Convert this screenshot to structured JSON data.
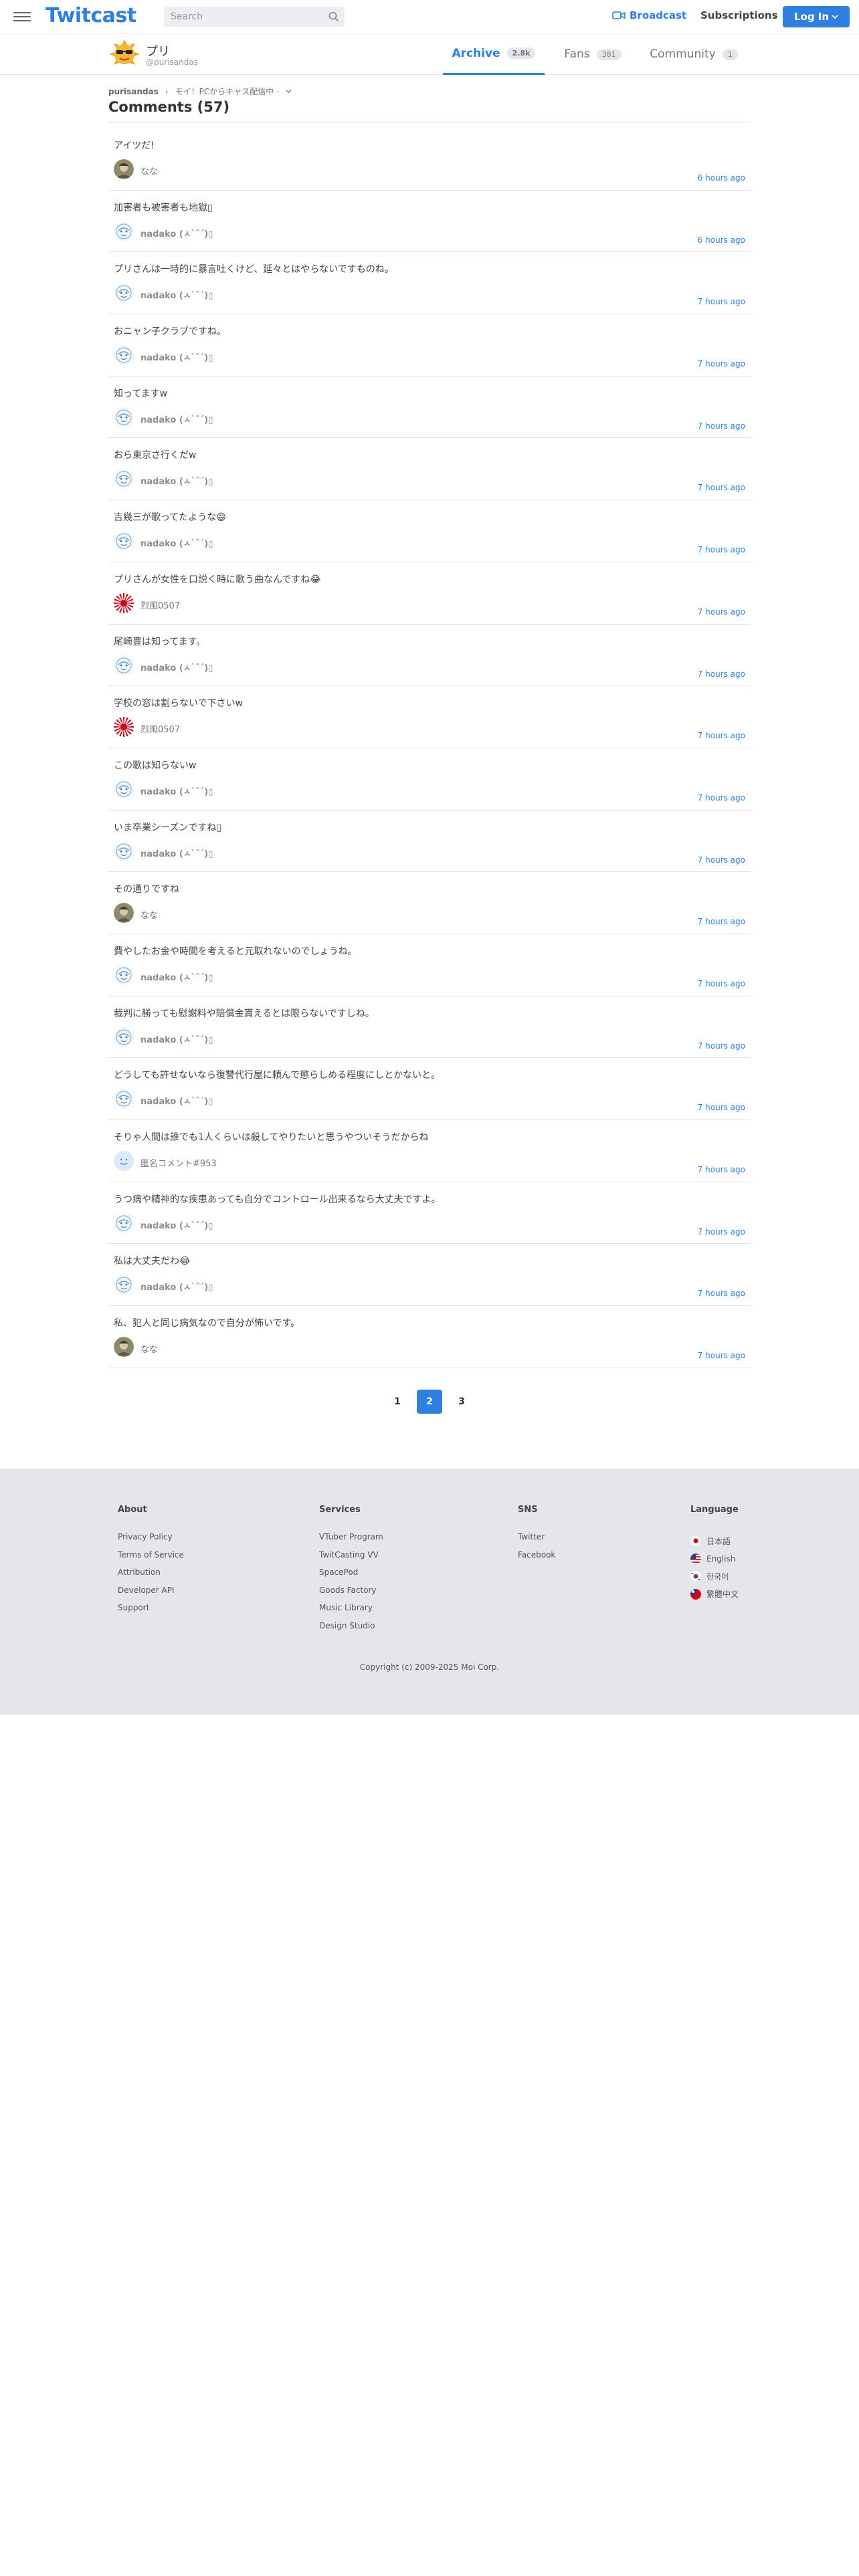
{
  "header": {
    "logo": "Twitcast",
    "search_placeholder": "Search",
    "broadcast_label": "Broadcast",
    "subscriptions_label": "Subscriptions",
    "login_label": "Log In",
    "accent_color": "#2f7fe0"
  },
  "profile": {
    "name": "プリ",
    "handle": "@purisandas",
    "tabs": [
      {
        "label": "Archive",
        "count": "2.8k",
        "active": true
      },
      {
        "label": "Fans",
        "count": "381",
        "active": false
      },
      {
        "label": "Community",
        "count": "1",
        "active": false
      }
    ]
  },
  "breadcrumb": {
    "user": "purisandas",
    "separator": "›",
    "movie": "モイ！PCからキャス配信中 -"
  },
  "page_title": "Comments (57)",
  "comments": [
    {
      "text": "アイツだ!",
      "author": "なな",
      "author_style": "normal",
      "avatar": "photo-olive",
      "time": "6 hours ago"
    },
    {
      "text": "加害者も被害者も地獄▯",
      "author": "nadako (ㅅ`ˆ´)▯",
      "author_style": "bold",
      "avatar": "sketch",
      "time": "6 hours ago"
    },
    {
      "text": "プリさんは一時的に暴言吐くけど、延々とはやらないですものね。",
      "author": "nadako (ㅅ`ˆ´)▯",
      "author_style": "bold",
      "avatar": "sketch",
      "time": "7 hours ago"
    },
    {
      "text": "おニャン子クラブですね。",
      "author": "nadako (ㅅ`ˆ´)▯",
      "author_style": "bold",
      "avatar": "sketch",
      "time": "7 hours ago"
    },
    {
      "text": "知ってますw",
      "author": "nadako (ㅅ`ˆ´)▯",
      "author_style": "bold",
      "avatar": "sketch",
      "time": "7 hours ago"
    },
    {
      "text": "おら東京さ行くだw",
      "author": "nadako (ㅅ`ˆ´)▯",
      "author_style": "bold",
      "avatar": "sketch",
      "time": "7 hours ago"
    },
    {
      "text": "吉幾三が歌ってたような😄",
      "author": "nadako (ㅅ`ˆ´)▯",
      "author_style": "bold",
      "avatar": "sketch",
      "time": "7 hours ago"
    },
    {
      "text": "プリさんが女性を口説く時に歌う曲なんですね😂",
      "author": "烈風0507",
      "author_style": "normal",
      "avatar": "rising-sun",
      "time": "7 hours ago"
    },
    {
      "text": "尾崎豊は知ってます。",
      "author": "nadako (ㅅ`ˆ´)▯",
      "author_style": "bold",
      "avatar": "sketch",
      "time": "7 hours ago"
    },
    {
      "text": "学校の窓は割らないで下さいw",
      "author": "烈風0507",
      "author_style": "normal",
      "avatar": "rising-sun",
      "time": "7 hours ago"
    },
    {
      "text": "この歌は知らないw",
      "author": "nadako (ㅅ`ˆ´)▯",
      "author_style": "bold",
      "avatar": "sketch",
      "time": "7 hours ago"
    },
    {
      "text": "いま卒業シーズンですね▯",
      "author": "nadako (ㅅ`ˆ´)▯",
      "author_style": "bold",
      "avatar": "sketch",
      "time": "7 hours ago"
    },
    {
      "text": "その通りですね",
      "author": "なな",
      "author_style": "normal",
      "avatar": "photo-olive",
      "time": "7 hours ago"
    },
    {
      "text": "費やしたお金や時間を考えると元取れないのでしょうね。",
      "author": "nadako (ㅅ`ˆ´)▯",
      "author_style": "bold",
      "avatar": "sketch",
      "time": "7 hours ago"
    },
    {
      "text": "裁判に勝っても慰謝料や賠償金貰えるとは限らないですしね。",
      "author": "nadako (ㅅ`ˆ´)▯",
      "author_style": "bold",
      "avatar": "sketch",
      "time": "7 hours ago"
    },
    {
      "text": "どうしても許せないなら復讐代行屋に頼んで懲らしめる程度にしとかないと。",
      "author": "nadako (ㅅ`ˆ´)▯",
      "author_style": "bold",
      "avatar": "sketch",
      "time": "7 hours ago"
    },
    {
      "text": "そりゃ人間は誰でも1人くらいは殺してやりたいと思うやついそうだからね",
      "author": "匿名コメント#953",
      "author_style": "normal",
      "avatar": "anon",
      "time": "7 hours ago"
    },
    {
      "text": "うつ病や精神的な疾患あっても自分でコントロール出来るなら大丈夫ですよ。",
      "author": "nadako (ㅅ`ˆ´)▯",
      "author_style": "bold",
      "avatar": "sketch",
      "time": "7 hours ago"
    },
    {
      "text": "私は大丈夫だわ😂",
      "author": "nadako (ㅅ`ˆ´)▯",
      "author_style": "bold",
      "avatar": "sketch",
      "time": "7 hours ago"
    },
    {
      "text": "私、犯人と同じ病気なので自分が怖いです。",
      "author": "なな",
      "author_style": "normal",
      "avatar": "photo-olive",
      "time": "7 hours ago"
    }
  ],
  "pagination": {
    "pages": [
      "1",
      "2",
      "3"
    ],
    "current": "2"
  },
  "footer": {
    "about": {
      "title": "About",
      "links": [
        "Privacy Policy",
        "Terms of Service",
        "Attribution",
        "Developer API",
        "Support"
      ]
    },
    "services": {
      "title": "Services",
      "links": [
        "VTuber Program",
        "TwitCasting VV",
        "SpacePod",
        "Goods Factory",
        "Music Library",
        "Design Studio"
      ]
    },
    "sns": {
      "title": "SNS",
      "links": [
        "Twitter",
        "Facebook"
      ]
    },
    "language": {
      "title": "Language",
      "items": [
        {
          "label": "日本語",
          "flag": "jp"
        },
        {
          "label": "English",
          "flag": "us"
        },
        {
          "label": "한국어",
          "flag": "kr"
        },
        {
          "label": "繁體中文",
          "flag": "tw"
        }
      ]
    },
    "copyright": "Copyright (c) 2009-2025 Moi Corp."
  }
}
